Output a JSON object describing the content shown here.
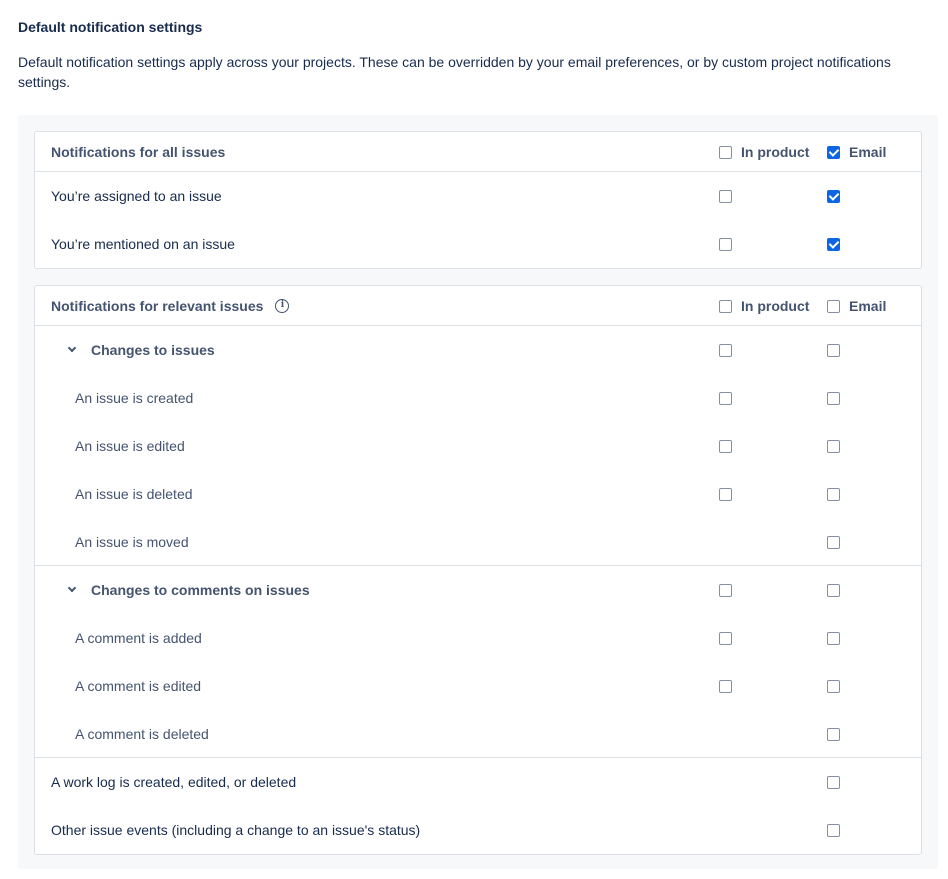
{
  "page": {
    "title": "Default notification settings",
    "description": "Default notification settings apply across your projects. These can be overridden by your email preferences, or by custom project notifications settings."
  },
  "all_issues": {
    "header": "Notifications for all issues",
    "col_in_product": "In product",
    "col_email": "Email",
    "header_in_product_checked": false,
    "header_email_checked": true,
    "rows": [
      {
        "label": "You’re assigned to an issue",
        "in_product": false,
        "email": true
      },
      {
        "label": "You’re mentioned on an issue",
        "in_product": false,
        "email": true
      }
    ]
  },
  "relevant_issues": {
    "header": "Notifications for relevant issues",
    "col_in_product": "In product",
    "col_email": "Email",
    "header_in_product_checked": false,
    "header_email_checked": false,
    "groups": [
      {
        "label": "Changes to issues",
        "in_product": false,
        "email": false,
        "items": [
          {
            "label": "An issue is created",
            "in_product": false,
            "email": false
          },
          {
            "label": "An issue is edited",
            "in_product": false,
            "email": false
          },
          {
            "label": "An issue is deleted",
            "in_product": false,
            "email": false
          },
          {
            "label": "An issue is moved",
            "in_product": null,
            "email": false
          }
        ]
      },
      {
        "label": "Changes to comments on issues",
        "in_product": false,
        "email": false,
        "items": [
          {
            "label": "A comment is added",
            "in_product": false,
            "email": false
          },
          {
            "label": "A comment is edited",
            "in_product": false,
            "email": false
          },
          {
            "label": "A comment is deleted",
            "in_product": null,
            "email": false
          }
        ]
      }
    ],
    "others": [
      {
        "label": "A work log is created, edited, or deleted",
        "in_product": null,
        "email": false
      },
      {
        "label": "Other issue events (including a change to an issue's status)",
        "in_product": null,
        "email": false
      }
    ]
  },
  "colors": {
    "checked": "#0c66e4",
    "text": "#172b4d",
    "subtle_text": "#44546f",
    "border": "#dcdfe4",
    "panel_bg": "#f7f8f9"
  }
}
